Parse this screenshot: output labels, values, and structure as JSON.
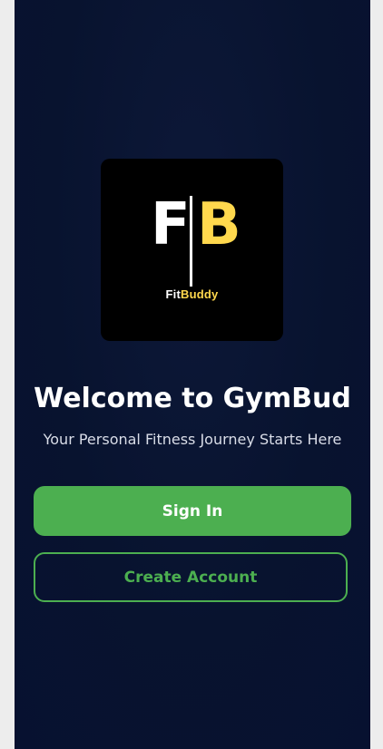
{
  "logo": {
    "letter_left": "F",
    "letter_right": "B",
    "caption_part1": "Fit",
    "caption_part2": "Buddy",
    "brand_colors": {
      "white": "#ffffff",
      "yellow": "#ffd84d",
      "background": "#000000"
    }
  },
  "welcome": {
    "title": "Welcome to GymBud",
    "subtitle": "Your Personal Fitness Journey Starts Here"
  },
  "actions": {
    "sign_in_label": "Sign In",
    "create_account_label": "Create Account"
  },
  "theme": {
    "background": "#08132f",
    "accent_green": "#4caf50"
  }
}
